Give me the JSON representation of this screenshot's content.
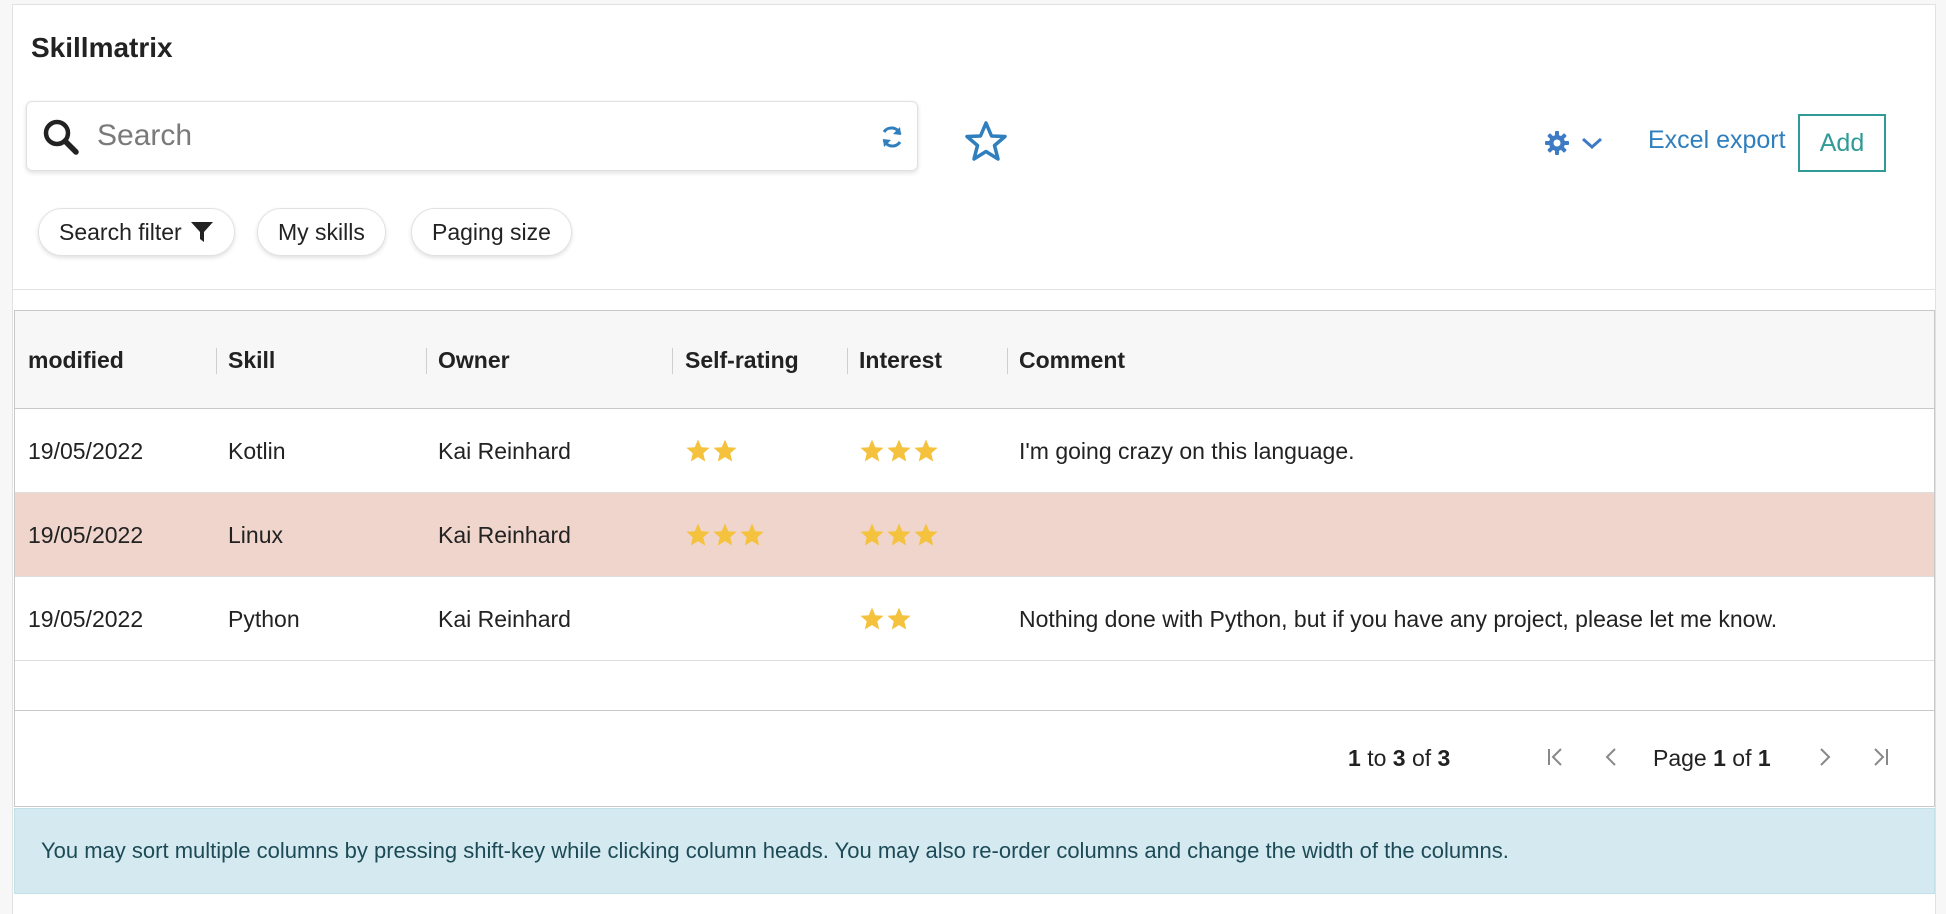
{
  "page": {
    "title": "Skillmatrix"
  },
  "toolbar": {
    "search_placeholder": "Search",
    "excel_export_label": "Excel export",
    "add_label": "Add"
  },
  "filters": [
    {
      "label": "Search filter",
      "icon": "filter-icon"
    },
    {
      "label": "My skills"
    },
    {
      "label": "Paging size"
    }
  ],
  "table": {
    "columns": [
      "modified",
      "Skill",
      "Owner",
      "Self-rating",
      "Interest",
      "Comment"
    ],
    "rows": [
      {
        "modified": "19/05/2022",
        "skill": "Kotlin",
        "owner": "Kai Reinhard",
        "self_rating": 2,
        "interest": 3,
        "comment": "I'm going crazy on this language.",
        "highlighted": false
      },
      {
        "modified": "19/05/2022",
        "skill": "Linux",
        "owner": "Kai Reinhard",
        "self_rating": 3,
        "interest": 3,
        "comment": "",
        "highlighted": true
      },
      {
        "modified": "19/05/2022",
        "skill": "Python",
        "owner": "Kai Reinhard",
        "self_rating": 0,
        "interest": 2,
        "comment": "Nothing done with Python, but if you have any project, please let me know.",
        "highlighted": false
      }
    ]
  },
  "pagination": {
    "from": "1",
    "to_word": "to",
    "to": "3",
    "of_word": "of",
    "total": "3",
    "page_word": "Page",
    "page": "1",
    "page_of_word": "of",
    "page_total": "1"
  },
  "info_text": "You may sort multiple columns by pressing shift-key while clicking column heads. You may also re-order columns and change the width of the columns.",
  "colors": {
    "accent": "#2f7fbf",
    "add_button": "#2f9a96",
    "star": "#f5c23e",
    "highlight_row": "#efd5cc",
    "info_bg": "#d5eaf0"
  }
}
